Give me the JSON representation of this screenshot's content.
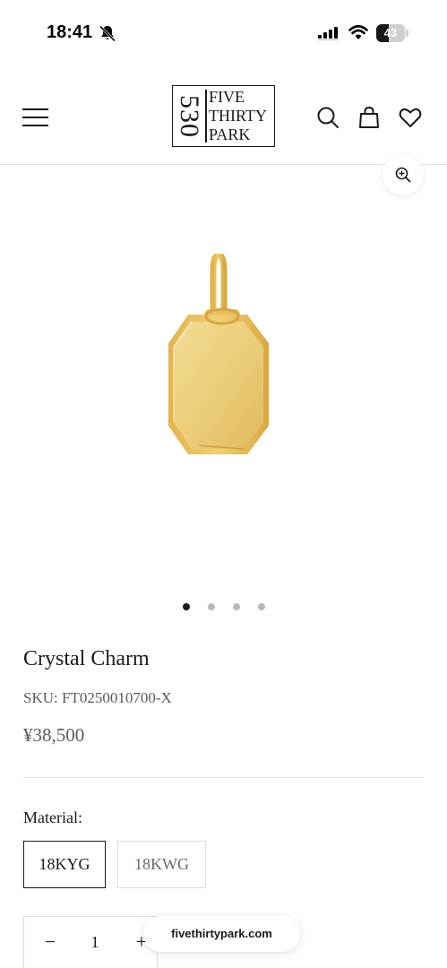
{
  "status_bar": {
    "time": "18:41",
    "battery_level": "43",
    "icons": [
      "bell-slash-icon",
      "signal-icon",
      "wifi-icon",
      "battery-icon"
    ]
  },
  "header": {
    "logo": {
      "number": "530",
      "line1": "FIVE",
      "line2": "THIRTY",
      "line3": "PARK"
    },
    "icons": [
      "menu-icon",
      "search-icon",
      "bag-icon",
      "heart-icon"
    ]
  },
  "gallery": {
    "image_count": 4,
    "active_index": 0,
    "image_color": "#e8c56a"
  },
  "product": {
    "title": "Crystal Charm",
    "sku": "SKU: FT0250010700-X",
    "price": "¥38,500",
    "material_label": "Material:",
    "materials": [
      {
        "label": "18KYG",
        "selected": true
      },
      {
        "label": "18KWG",
        "selected": false
      }
    ],
    "quantity": {
      "minus": "−",
      "value": "1",
      "plus": "+"
    }
  },
  "browser": {
    "url": "fivethirtypark.com"
  },
  "colors": {
    "text": "#1a1a1a",
    "muted": "#5a5a5a",
    "border": "#dcdcdc",
    "gold": "#e8c56a"
  }
}
